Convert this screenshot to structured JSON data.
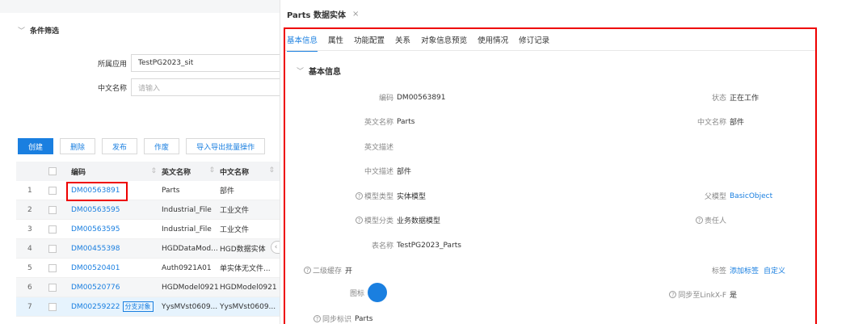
{
  "filter": {
    "title": "条件筛选",
    "app_label": "所属应用",
    "app_value": "TestPG2023_sit",
    "cn_label": "中文名称",
    "cn_placeholder": "请输入"
  },
  "toolbar": {
    "create": "创建",
    "delete": "删除",
    "publish": "发布",
    "void": "作废",
    "import_export": "导入导出批量操作"
  },
  "table": {
    "headers": {
      "code": "编码",
      "en_name": "英文名称",
      "cn_name": "中文名称"
    },
    "rows": [
      {
        "idx": "1",
        "code": "DM00563891",
        "en": "Parts",
        "cn": "部件",
        "tag": ""
      },
      {
        "idx": "2",
        "code": "DM00563595",
        "en": "Industrial_File",
        "cn": "工业文件",
        "tag": ""
      },
      {
        "idx": "3",
        "code": "DM00563595",
        "en": "Industrial_File",
        "cn": "工业文件",
        "tag": ""
      },
      {
        "idx": "4",
        "code": "DM00455398",
        "en": "HGDDataMod...",
        "cn": "HGD数据实体",
        "tag": ""
      },
      {
        "idx": "5",
        "code": "DM00520401",
        "en": "Auth0921A01",
        "cn": "单实体无文件...",
        "tag": ""
      },
      {
        "idx": "6",
        "code": "DM00520776",
        "en": "HGDModel0921",
        "cn": "HGDModel0921",
        "tag": ""
      },
      {
        "idx": "7",
        "code": "DM00259222",
        "en": "YysMVst0609...",
        "cn": "YysMVst0609...",
        "tag": "分支对象"
      }
    ]
  },
  "doc_tab": {
    "title": "Parts 数据实体"
  },
  "subtabs": [
    "基本信息",
    "属性",
    "功能配置",
    "关系",
    "对象信息预览",
    "使用情况",
    "修订记录"
  ],
  "section_title": "基本信息",
  "fields": {
    "code_label": "编码",
    "code_value": "DM00563891",
    "status_label": "状态",
    "status_value": "正在工作",
    "en_label": "英文名称",
    "en_value": "Parts",
    "cn_label": "中文名称",
    "cn_value": "部件",
    "en_desc_label": "英文描述",
    "cn_desc_label": "中文描述",
    "cn_desc_value": "部件",
    "model_type_label": "模型类型",
    "model_type_value": "实体模型",
    "parent_label": "父模型",
    "parent_value": "BasicObject",
    "model_cat_label": "模型分类",
    "model_cat_value": "业务数据模型",
    "owner_label": "责任人",
    "table_label": "表名称",
    "table_value": "TestPG2023_Parts",
    "cache_label": "二级缓存",
    "cache_value": "开",
    "tags_label": "标签",
    "tags_add": "添加标签",
    "tags_custom": "自定义",
    "icon_label": "图标",
    "sync_label": "同步至LinkX-F",
    "sync_value": "是",
    "sync_id_label": "同步标识",
    "sync_id_value": "Parts"
  },
  "colors": {
    "accent": "#1a7fe0",
    "highlight": "#e00000"
  }
}
